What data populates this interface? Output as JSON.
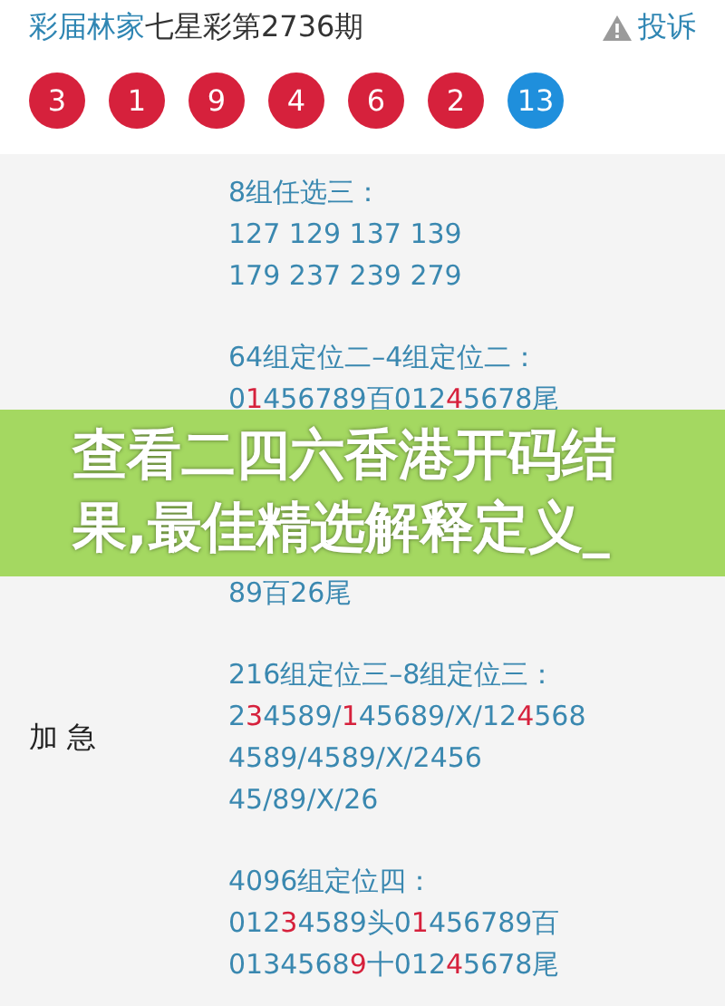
{
  "header": {
    "brand": "彩届林家",
    "title": "七星彩第2736期",
    "report": "投诉"
  },
  "balls": [
    {
      "number": "3",
      "color": "#d6213c"
    },
    {
      "number": "1",
      "color": "#d6213c"
    },
    {
      "number": "9",
      "color": "#d6213c"
    },
    {
      "number": "4",
      "color": "#d6213c"
    },
    {
      "number": "6",
      "color": "#d6213c"
    },
    {
      "number": "2",
      "color": "#d6213c"
    },
    {
      "number": "13",
      "color": "#1f8fdc"
    }
  ],
  "blocks": [
    {
      "kind": "section",
      "title": "8组任选三：",
      "lines": [
        [
          {
            "text": "127 129 137 139",
            "hit": false
          }
        ],
        [
          {
            "text": "179 237 239 279",
            "hit": false
          }
        ]
      ]
    },
    {
      "kind": "section",
      "title": "64组定位二–4组定位二：",
      "lines": [
        [
          {
            "text": "0",
            "hit": false
          },
          {
            "text": "1",
            "hit": true
          },
          {
            "text": "456789百012",
            "hit": false
          },
          {
            "text": "4",
            "hit": true
          },
          {
            "text": "5678尾",
            "hit": false
          }
        ]
      ]
    },
    {
      "kind": "banner",
      "text": "查看二四六香港开码结果,最佳精选解释定义_"
    },
    {
      "kind": "section",
      "lines": [
        [
          {
            "text": "89百26尾",
            "hit": false
          }
        ]
      ]
    },
    {
      "kind": "section",
      "side_label": "加 急",
      "title": "216组定位三–8组定位三：",
      "lines": [
        [
          {
            "text": "2",
            "hit": false
          },
          {
            "text": "3",
            "hit": true
          },
          {
            "text": "4589/",
            "hit": false
          },
          {
            "text": "1",
            "hit": true
          },
          {
            "text": "45689/X/12",
            "hit": false
          },
          {
            "text": "4",
            "hit": true
          },
          {
            "text": "568",
            "hit": false
          }
        ],
        [
          {
            "text": "4589/4589/X/2456",
            "hit": false
          }
        ],
        [
          {
            "text": "45/89/X/26",
            "hit": false
          }
        ]
      ]
    },
    {
      "kind": "section",
      "title": "4096组定位四：",
      "lines": [
        [
          {
            "text": "012",
            "hit": false
          },
          {
            "text": "3",
            "hit": true
          },
          {
            "text": "4589头0",
            "hit": false
          },
          {
            "text": "1",
            "hit": true
          },
          {
            "text": "456789百",
            "hit": false
          }
        ],
        [
          {
            "text": "0134568",
            "hit": false
          },
          {
            "text": "9",
            "hit": true
          },
          {
            "text": "十012",
            "hit": false
          },
          {
            "text": "4",
            "hit": true
          },
          {
            "text": "5678尾",
            "hit": false
          }
        ]
      ]
    }
  ]
}
